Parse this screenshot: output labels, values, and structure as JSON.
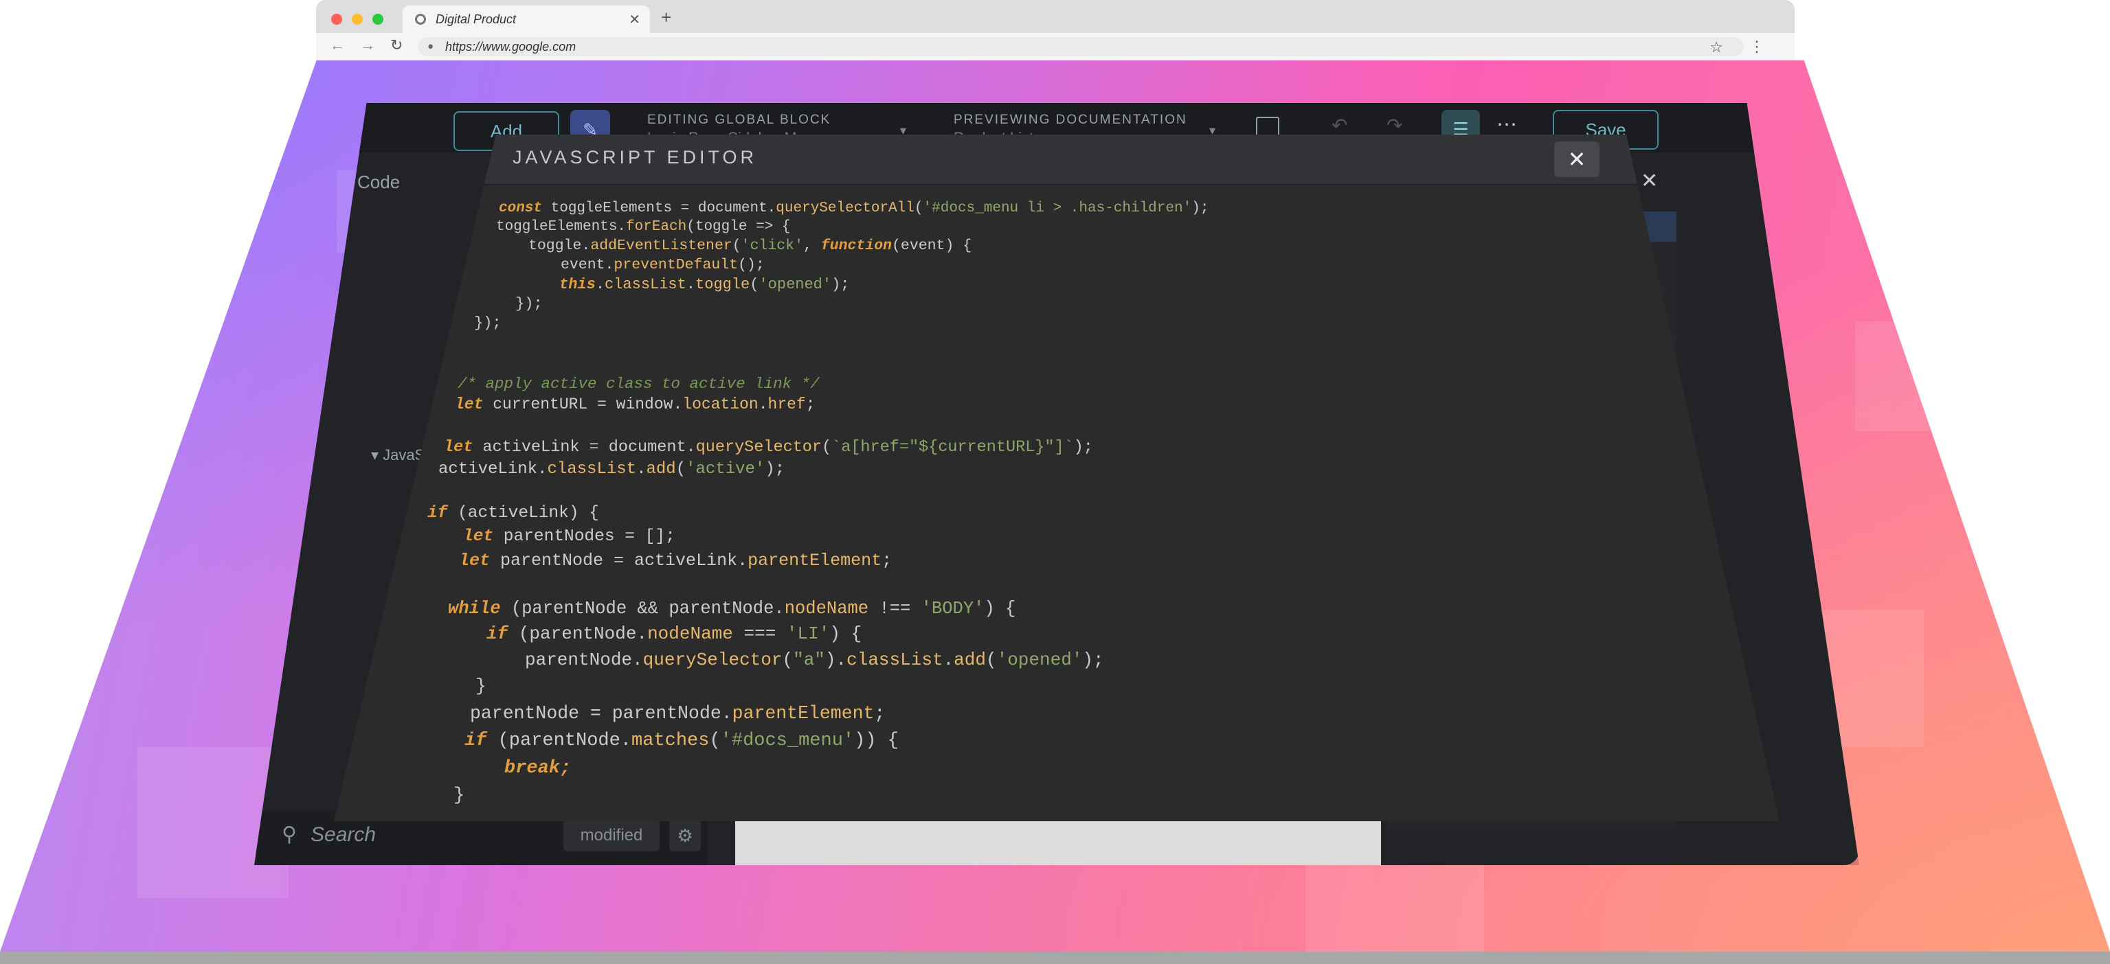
{
  "browser": {
    "tab_title": "Digital Product",
    "tab_close": "✕",
    "new_tab": "+",
    "url": "https://www.google.com",
    "back_icon": "←",
    "forward_icon": "→",
    "reload_icon": "↻",
    "lock_icon": "🔒",
    "star_icon": "☆",
    "menu_icon": "⋮"
  },
  "app": {
    "toolbar": {
      "add_label": "Add",
      "editing_label": "EDITING GLOBAL BLOCK",
      "editing_value": "Login Page Sidebar Menu",
      "previewing_label": "PREVIEWING DOCUMENTATION",
      "previewing_value": "Product List",
      "save_label": "Save"
    },
    "side_panel": {
      "header": "Code",
      "js_label": "▾ JavaScript"
    },
    "search": {
      "placeholder": "Search"
    },
    "modified_label": "modified"
  },
  "modal": {
    "title": "JAVASCRIPT EDITOR",
    "close_icon": "✕",
    "code_lines": [
      "const toggleElements = document.querySelectorAll('#docs_menu li > .has-children');",
      "toggleElements.forEach(toggle => {",
      "toggle.addEventListener('click', function(event) {",
      "event.preventDefault();",
      "this.classList.toggle('opened');",
      "});",
      "});",
      "/* apply active class to active link */",
      "let currentURL = window.location.href;",
      "let activeLink = document.querySelector(`a[href=\"${currentURL}\"]`);",
      "activeLink.classList.add('active');",
      "if (activeLink) {",
      "let parentNodes = [];",
      "let parentNode = activeLink.parentElement;",
      "while (parentNode && parentNode.nodeName !== 'BODY') {",
      "if (parentNode.nodeName === 'LI') {",
      "parentNode.querySelector(\"a\").classList.add('opened');",
      "}",
      "parentNode = parentNode.parentElement;",
      "if (parentNode.matches('#docs_menu')) {",
      "break;",
      "}"
    ]
  },
  "colors": {
    "keyword": "#e59e3d",
    "function": "#e7b86a",
    "string": "#8fa86a",
    "comment": "#7a9a53",
    "modal_bg": "#2b2b2c"
  }
}
